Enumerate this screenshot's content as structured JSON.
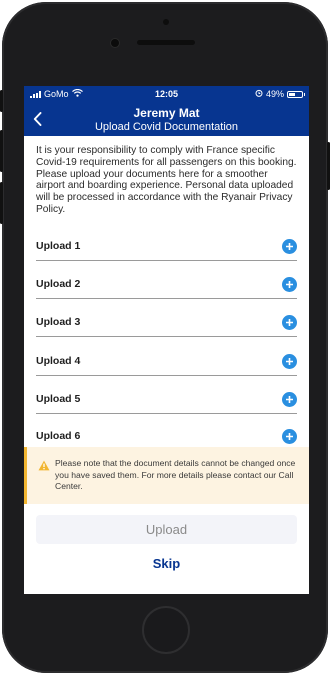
{
  "status_bar": {
    "carrier": "GoMo",
    "time": "12:05",
    "battery": "49%",
    "battery_level": 0.49,
    "signal_icon": "cellular-signal-icon",
    "wifi_icon": "wifi-icon",
    "alarm_icon": "alarm-icon"
  },
  "header": {
    "title": "Jeremy Mat",
    "subtitle": "Upload Covid Documentation",
    "back_icon": "chevron-left-icon"
  },
  "intro_text": "It is your responsibility to comply with France specific Covid-19 requirements for all passengers on this booking. Please upload your documents here for a smoother airport and boarding experience. Personal data uploaded will be processed in accordance with the Ryanair Privacy Policy.",
  "uploads": [
    {
      "label": "Upload 1"
    },
    {
      "label": "Upload 2"
    },
    {
      "label": "Upload 3"
    },
    {
      "label": "Upload 4"
    },
    {
      "label": "Upload 5"
    },
    {
      "label": "Upload 6"
    }
  ],
  "notice": {
    "icon": "warning-icon",
    "text": "Please note that the document details cannot be changed once you have saved them. For more details please contact our Call Center."
  },
  "actions": {
    "upload_label": "Upload",
    "skip_label": "Skip"
  },
  "colors": {
    "brand_blue": "#073590",
    "accent_blue": "#2a8fe0",
    "warning_yellow": "#f2b631",
    "notice_bg": "#fdf3e1"
  }
}
